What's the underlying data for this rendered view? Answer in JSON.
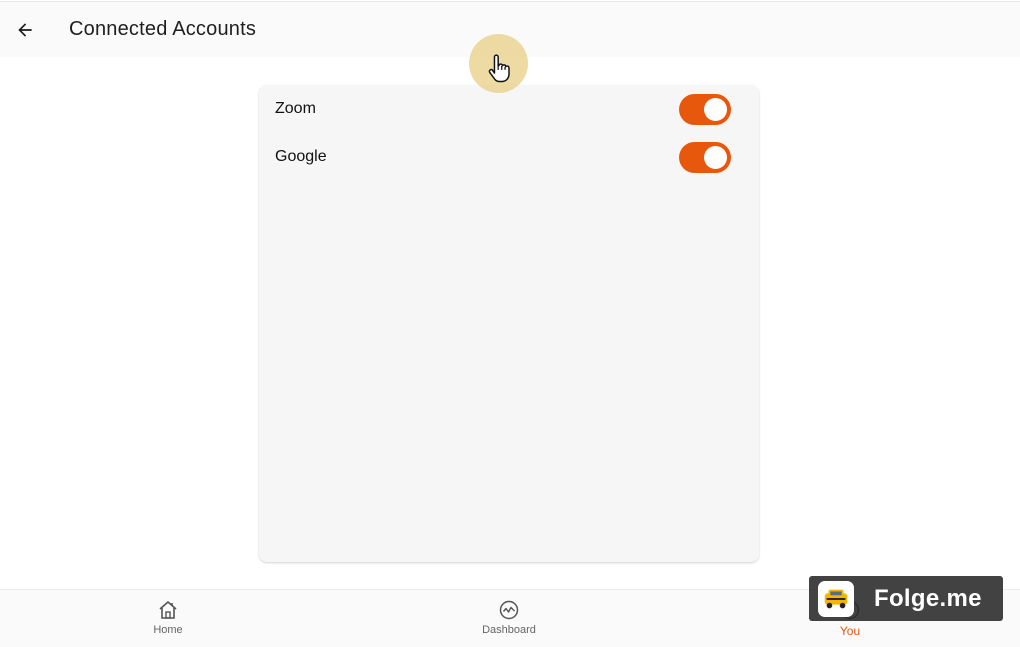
{
  "header": {
    "title": "Connected Accounts",
    "back_icon": "arrow-left-icon"
  },
  "accounts": [
    {
      "name": "Zoom",
      "enabled": true
    },
    {
      "name": "Google",
      "enabled": true
    }
  ],
  "bottom_nav": {
    "items": [
      {
        "label": "Home",
        "icon": "home-icon",
        "active": false
      },
      {
        "label": "Dashboard",
        "icon": "dashboard-icon",
        "active": false
      },
      {
        "label": "You",
        "icon": "person-icon",
        "active": true
      }
    ]
  },
  "watermark": {
    "text": "Folge.me"
  },
  "colors": {
    "accent": "#e8580c",
    "touch_indicator": "#e8d28c",
    "card_background": "#f6f6f6"
  }
}
